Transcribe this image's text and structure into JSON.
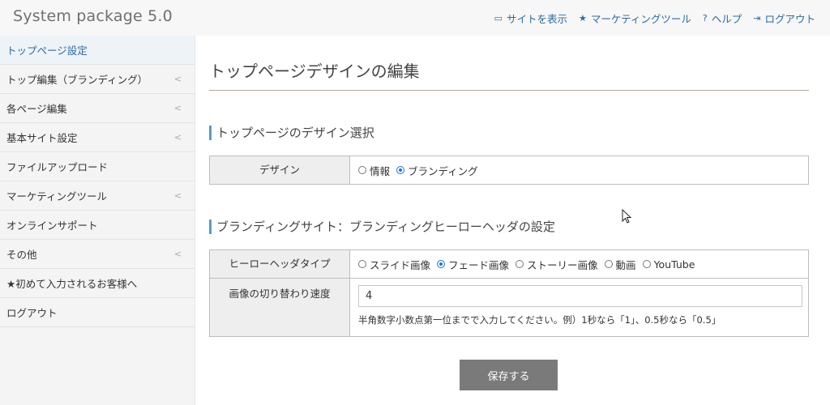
{
  "app": {
    "title": "System package 5.0"
  },
  "topnav": [
    {
      "label": "サイトを表示",
      "icon": "monitor-icon"
    },
    {
      "label": "マーケティングツール",
      "icon": "star-icon"
    },
    {
      "label": "ヘルプ",
      "icon": "question-icon"
    },
    {
      "label": "ログアウト",
      "icon": "logout-icon"
    }
  ],
  "sidebar": {
    "items": [
      {
        "label": "トップページ設定",
        "chevron": ""
      },
      {
        "label": "トップ編集（ブランディング）",
        "chevron": "<"
      },
      {
        "label": "各ページ編集",
        "chevron": "<"
      },
      {
        "label": "基本サイト設定",
        "chevron": "<"
      },
      {
        "label": "ファイルアップロード",
        "chevron": ""
      },
      {
        "label": "マーケティングツール",
        "chevron": "<"
      },
      {
        "label": "オンラインサポート",
        "chevron": ""
      },
      {
        "label": "その他",
        "chevron": "<"
      },
      {
        "label": "★初めて入力されるお客様へ",
        "chevron": ""
      },
      {
        "label": "ログアウト",
        "chevron": ""
      }
    ]
  },
  "main": {
    "page_title": "トップページデザインの編集",
    "section1": {
      "title": "トップページのデザイン選択",
      "design_label": "デザイン",
      "options": [
        {
          "label": "情報",
          "selected": false
        },
        {
          "label": "ブランディング",
          "selected": true
        }
      ]
    },
    "section2": {
      "title": "ブランディングサイト：ブランディングヒーローヘッダの設定",
      "hero_label": "ヒーローヘッダタイプ",
      "hero_options": [
        {
          "label": "スライド画像",
          "selected": false
        },
        {
          "label": "フェード画像",
          "selected": true
        },
        {
          "label": "ストーリー画像",
          "selected": false
        },
        {
          "label": "動画",
          "selected": false
        },
        {
          "label": "YouTube",
          "selected": false
        }
      ],
      "speed_label": "画像の切り替わり速度",
      "speed_value": "4",
      "speed_hint": "半角数字小数点第一位までで入力してください。例）1秒なら「1」、0.5秒なら「0.5」"
    },
    "save_label": "保存する"
  },
  "colors": {
    "accent": "#5a9bc5",
    "link": "#2b6aa6",
    "button": "#7a7a7a"
  }
}
